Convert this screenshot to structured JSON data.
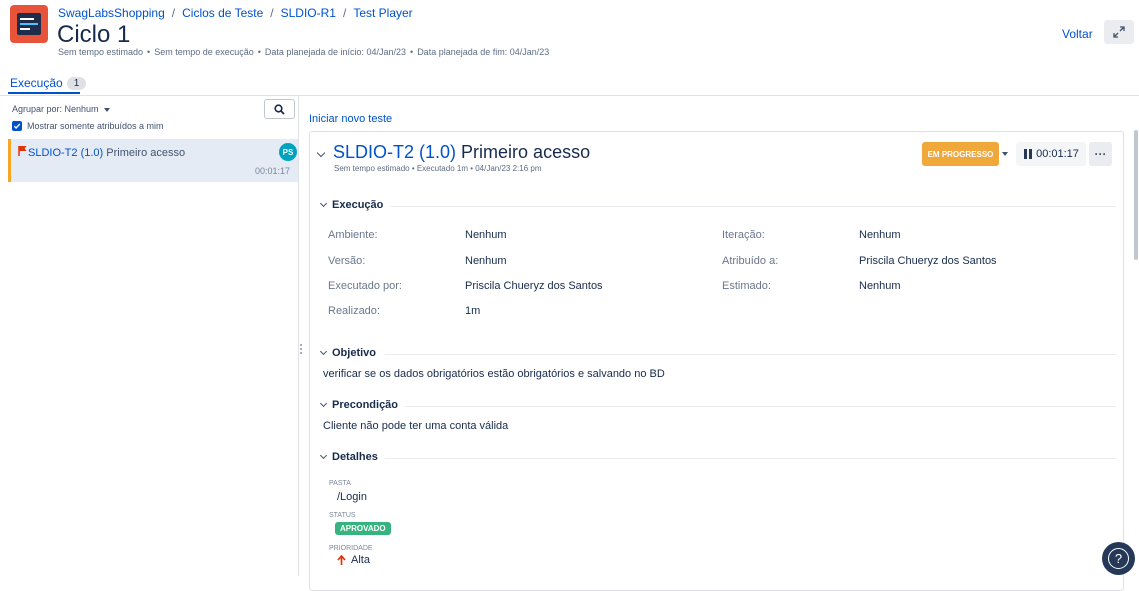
{
  "breadcrumb": [
    "SwagLabsShopping",
    "Ciclos de Teste",
    "SLDIO-R1",
    "Test Player"
  ],
  "page_title": "Ciclo 1",
  "meta": [
    "Sem tempo estimado",
    "Sem tempo de execução",
    "Data planejada de início: 04/Jan/23",
    "Data planejada de fim: 04/Jan/23"
  ],
  "actions": {
    "back": "Voltar"
  },
  "tabs": [
    {
      "label": "Execução",
      "count": "1"
    }
  ],
  "left": {
    "group_by": "Agrupar por: Nenhum",
    "only_mine": "Mostrar somente atribuídos a mim",
    "items": [
      {
        "key": "SLDIO-T2 (1.0)",
        "title": "Primeiro acesso",
        "avatar": "PS",
        "time": "00:01:17"
      }
    ]
  },
  "right": {
    "new_test": "Iniciar novo teste",
    "test": {
      "key": "SLDIO-T2 (1.0)",
      "title": "Primeiro acesso",
      "sub": [
        "Sem tempo estimado",
        "Executado 1m",
        "04/Jan/23 2:16 pm"
      ],
      "status": "EM PROGRESSO",
      "timer": "00:01:17"
    },
    "sections": {
      "execucao": "Execução",
      "objetivo": "Objetivo",
      "precondicao": "Precondição",
      "detalhes": "Detalhes"
    },
    "fields": {
      "ambiente_l": "Ambiente:",
      "ambiente_v": "Nenhum",
      "versao_l": "Versão:",
      "versao_v": "Nenhum",
      "executado_l": "Executado por:",
      "executado_v": "Priscila Chueryz dos Santos",
      "realizado_l": "Realizado:",
      "realizado_v": "1m",
      "iteracao_l": "Iteração:",
      "iteracao_v": "Nenhum",
      "atribuido_l": "Atribuído a:",
      "atribuido_v": "Priscila Chueryz dos Santos",
      "estimado_l": "Estimado:",
      "estimado_v": "Nenhum"
    },
    "objetivo_text": "verificar se os dados obrigatórios estão obrigatórios e salvando no BD",
    "precondicao_text": "Cliente não pode ter uma conta válida",
    "details": {
      "pasta_l": "PASTA",
      "pasta_v": "/Login",
      "status_l": "STATUS",
      "status_v": "APROVADO",
      "prioridade_l": "PRIORIDADE",
      "prioridade_v": "Alta"
    }
  },
  "colors": {
    "accent": "#0052cc",
    "status_in_progress": "#f1a83b",
    "approved": "#36b37e",
    "flag": "#de350b"
  }
}
